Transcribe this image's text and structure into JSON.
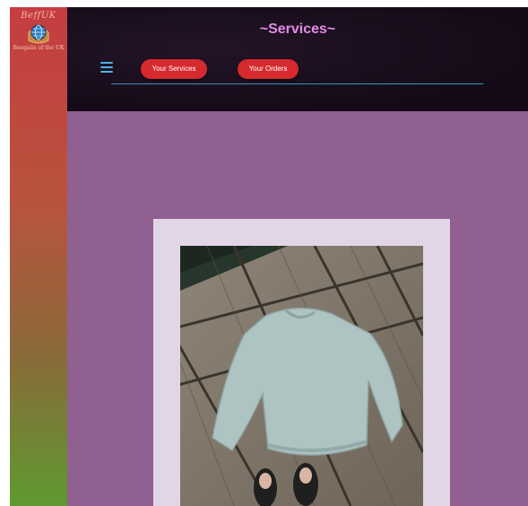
{
  "brand": {
    "name": "BeffUK",
    "tagline": "Bengalis of the UK",
    "logo_icon": "globe-icon"
  },
  "header": {
    "title": "~Services~",
    "menu_icon": "hamburger-menu-icon",
    "buttons": [
      {
        "label": "Your Services"
      },
      {
        "label": "Your Orders"
      }
    ]
  },
  "main": {
    "image": {
      "subject": "knitted-sweater-on-wooden-deck"
    }
  },
  "colors": {
    "accent": "#d62a2e",
    "title": "#e48be7",
    "background": "#906090",
    "card": "#e2d5e5",
    "header": "#150b18",
    "menu": "#49b3e6"
  }
}
